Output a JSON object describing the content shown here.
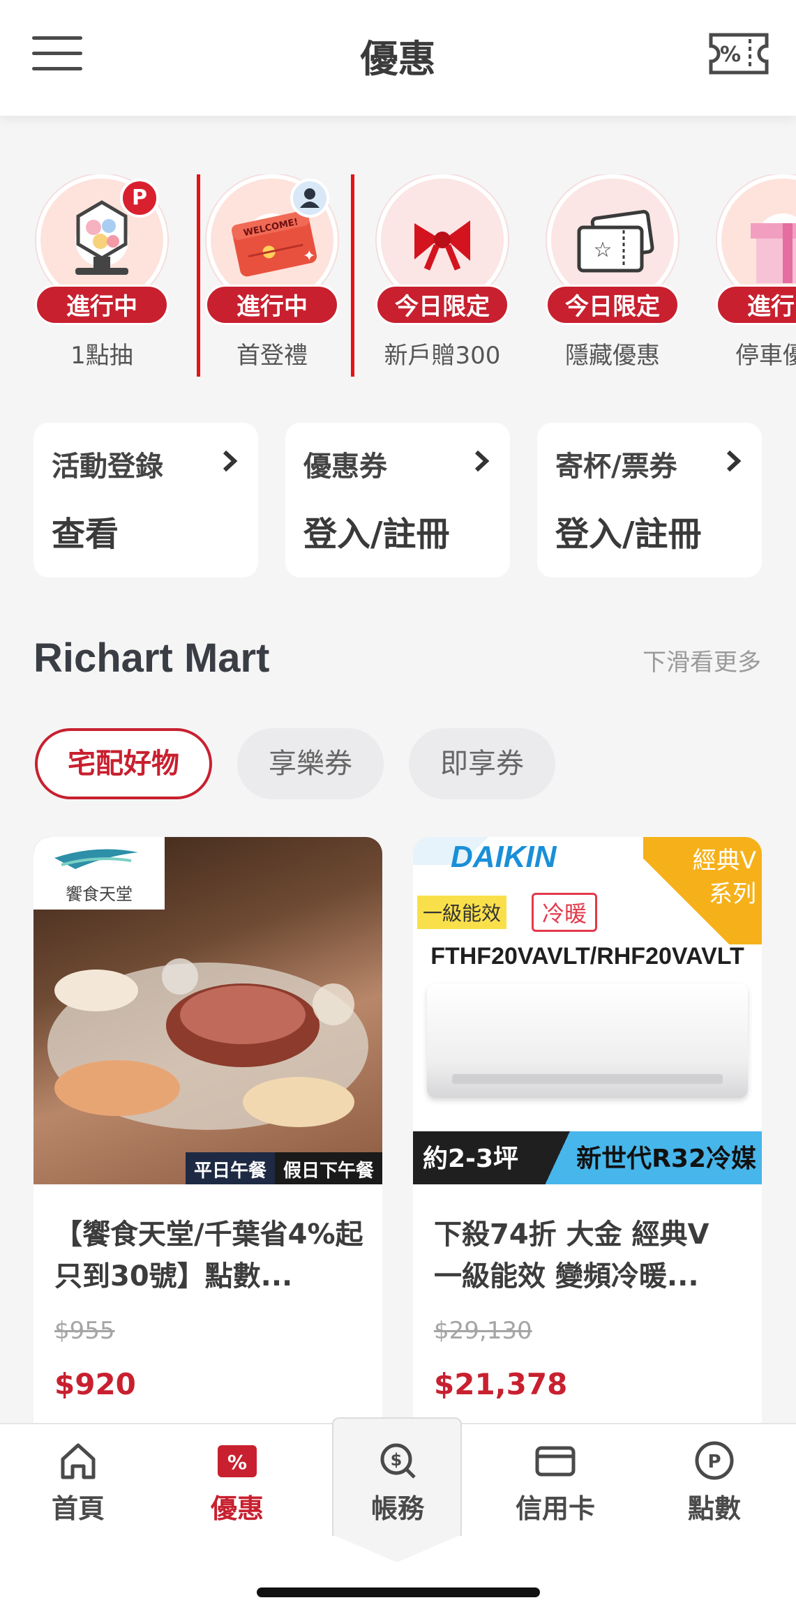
{
  "header": {
    "title": "優惠"
  },
  "stories": [
    {
      "badge": "進行中",
      "label": "1點抽",
      "corner_text": "P"
    },
    {
      "badge": "進行中",
      "label": "首登禮",
      "art_text": "WELCOME!"
    },
    {
      "badge": "今日限定",
      "label": "新戶贈300"
    },
    {
      "badge": "今日限定",
      "label": "隱藏優惠"
    },
    {
      "badge": "進行中",
      "label": "停車優惠"
    }
  ],
  "quick_links": [
    {
      "title": "活動登錄",
      "value": "查看"
    },
    {
      "title": "優惠券",
      "value": "登入/註冊"
    },
    {
      "title": "寄杯/票券",
      "value": "登入/註冊"
    }
  ],
  "section": {
    "title": "Richart Mart",
    "more": "下滑看更多"
  },
  "chips": [
    "宅配好物",
    "享樂券",
    "即享券"
  ],
  "products": [
    {
      "brand": "饗食天堂",
      "tag_a": "平日午餐",
      "tag_b": "假日下午餐",
      "name": "【饗食天堂/千葉省4%起 只到30號】點數...",
      "old_price": "$955",
      "price": "$920"
    },
    {
      "brand": "DAIKIN",
      "corner": "經典V系列",
      "energy": "一級能效",
      "mode": "冷暖",
      "model": "FTHF20VAVLT/RHF20VAVLT",
      "size": "約2-3坪",
      "refrigerant": "新世代R32冷媒",
      "name": "下殺74折 大金 經典V 一級能效 變頻冷暖...",
      "old_price": "$29,130",
      "price": "$21,378"
    }
  ],
  "tabs": [
    {
      "label": "首頁",
      "icon": "home-icon"
    },
    {
      "label": "優惠",
      "icon": "discount-icon"
    },
    {
      "label": "帳務",
      "icon": "billing-icon"
    },
    {
      "label": "信用卡",
      "icon": "credit-card-icon"
    },
    {
      "label": "點數",
      "icon": "points-icon"
    }
  ],
  "colors": {
    "brand_red": "#c8202f",
    "highlight": "#e31414",
    "daikin_blue": "#1a8fd8"
  }
}
